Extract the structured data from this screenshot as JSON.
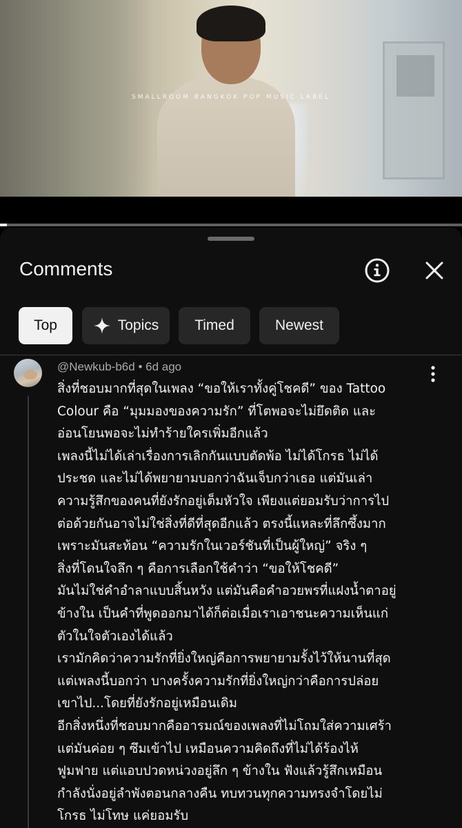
{
  "video": {
    "overlay_label": "SMALLROOM    BANGKOK POP MUSIC LABEL",
    "progress_fraction": 0.015
  },
  "comments_panel": {
    "title": "Comments",
    "info_icon": "info-icon",
    "close_icon": "close-icon",
    "chips": [
      {
        "label": "Top",
        "active": true
      },
      {
        "label": "Topics",
        "icon": "sparkle-icon",
        "active": false
      },
      {
        "label": "Timed",
        "active": false
      },
      {
        "label": "Newest",
        "active": false
      }
    ]
  },
  "comment": {
    "author": "@Newkub-b6d",
    "separator": "•",
    "time": "6d ago",
    "lines": [
      "สิ่งที่ชอบมากที่สุดในเพลง “ขอให้เราทั้งคู่โชคดี” ของ Tattoo",
      "Colour คือ “มุมมองของความรัก” ที่โตพอจะไม่ยึดติด และ",
      "อ่อนโยนพอจะไม่ทำร้ายใครเพิ่มอีกแล้ว",
      "เพลงนี้ไม่ได้เล่าเรื่องการเลิกกันแบบตัดพ้อ ไม่ได้โกรธ ไม่ได้",
      "ประชด และไม่ได้พยายามบอกว่าฉันเจ็บกว่าเธอ แต่มันเล่า",
      "ความรู้สึกของคนที่ยังรักอยู่เต็มหัวใจ เพียงแต่ยอมรับว่าการไป",
      "ต่อด้วยกันอาจไม่ใช่สิ่งที่ดีที่สุดอีกแล้ว ตรงนี้แหละที่ลึกซึ้งมาก",
      "เพราะมันสะท้อน “ความรักในเวอร์ชันที่เป็นผู้ใหญ่” จริง ๆ",
      "สิ่งที่โดนใจลึก ๆ คือการเลือกใช้คำว่า “ขอให้โชคดี”",
      "มันไม่ใช่คำอำลาแบบสิ้นหวัง แต่มันคือคำอวยพรที่แฝงน้ำตาอยู่",
      "ข้างใน เป็นคำที่พูดออกมาได้ก็ต่อเมื่อเราเอาชนะความเห็นแก่",
      "ตัวในใจตัวเองได้แล้ว",
      "เรามักคิดว่าความรักที่ยิ่งใหญ่คือการพยายามรั้งไว้ให้นานที่สุด",
      "แต่เพลงนี้บอกว่า บางครั้งความรักที่ยิ่งใหญ่กว่าคือการปล่อย",
      "เขาไป...โดยที่ยังรักอยู่เหมือนเดิม",
      "อีกสิ่งหนึ่งที่ชอบมากคืออารมณ์ของเพลงที่ไม่โถมใส่ความเศร้า",
      "แต่มันค่อย ๆ ซึมเข้าไป เหมือนความคิดถึงที่ไม่ได้ร้องไห้",
      "ฟูมฟาย แต่แอบปวดหน่วงอยู่ลึก ๆ ข้างใน ฟังแล้วรู้สึกเหมือน",
      "กำลังนั่งอยู่ลำพังตอนกลางคืน ทบทวนทุกความทรงจำโดยไม่",
      "โกรธ ไม่โทษ แค่ยอมรับ"
    ]
  }
}
